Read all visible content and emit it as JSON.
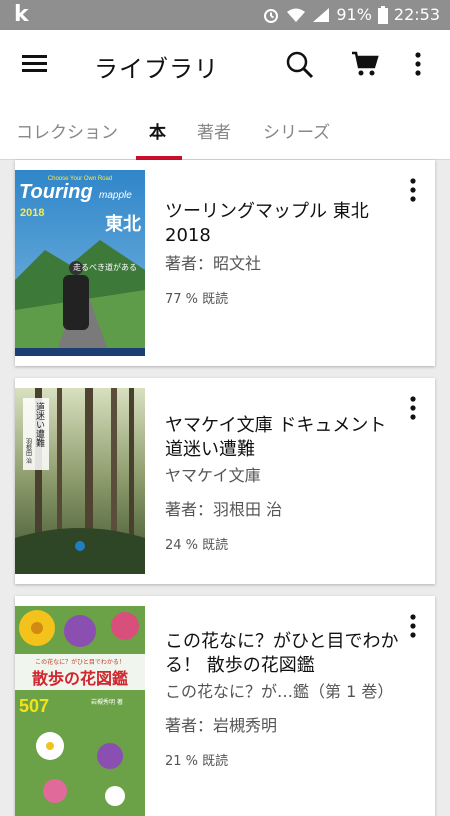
{
  "status": {
    "carrier": "k",
    "battery": "91%",
    "time": "22:53"
  },
  "app": {
    "title": "ライブラリ",
    "tabs": [
      {
        "label": "コレクション"
      },
      {
        "label": "本"
      },
      {
        "label": "著者"
      },
      {
        "label": "シリーズ"
      }
    ],
    "active_tab": "本"
  },
  "books": [
    {
      "title": "ツーリングマップル 東北 2018",
      "author": "著者：昭文社",
      "progress": "77 % 既読",
      "cover": {
        "top": "Choose Your Own Road",
        "brand": "Touring",
        "brand2": "mapple",
        "region": "東北",
        "year": "2018",
        "tagline": "走るべき道がある"
      }
    },
    {
      "title": "ヤマケイ文庫 ドキュメント 道迷い遭難",
      "series": "ヤマケイ文庫",
      "author": "著者：羽根田 治",
      "progress": "24 % 既読",
      "cover": {
        "vertical": "道迷い遭難",
        "subtitle": "羽根田 治"
      }
    },
    {
      "title": "この花なに？がひと目でわかる！ 散歩の花図鑑",
      "series": "この花なに？が…鑑（第 1 巻）",
      "author": "著者：岩槻秀明",
      "progress": "21 % 既読",
      "cover": {
        "top": "この花なに？がひと目でわかる！",
        "title": "散歩の花図鑑",
        "number": "507",
        "author": "岩槻秀明 著"
      }
    }
  ],
  "colors": {
    "accent": "#c8102e",
    "statusbar": "#8f8f8f"
  }
}
